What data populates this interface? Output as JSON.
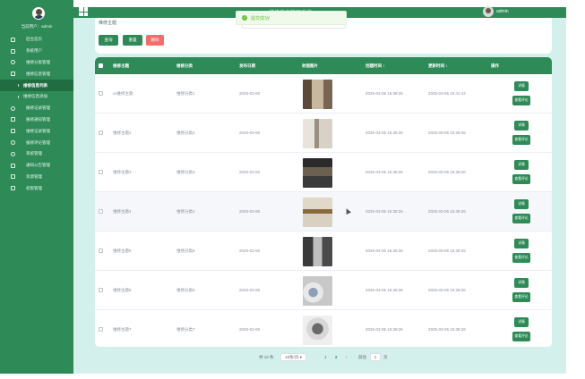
{
  "topbar": {
    "title": "维修信息管理系统",
    "user": "admin"
  },
  "toast": {
    "text": "提交成功!",
    "color": "#67c23a"
  },
  "sidebar": {
    "user_label": "当前用户：admin",
    "items": [
      {
        "label": "后台首页",
        "icon": "home-icon"
      },
      {
        "label": "系统用户",
        "icon": "users-icon"
      },
      {
        "label": "维修分类管理",
        "icon": "category-icon"
      },
      {
        "label": "维修信息管理",
        "icon": "document-icon"
      },
      {
        "label": "维修信息列表",
        "icon": "list-icon",
        "active": true
      },
      {
        "label": "维修信息添加",
        "icon": "add-icon"
      },
      {
        "label": "报修记录管理",
        "icon": "record-icon"
      },
      {
        "label": "报修通知管理",
        "icon": "notice-icon"
      },
      {
        "label": "维修记录管理",
        "icon": "wrench-icon"
      },
      {
        "label": "报修评论管理",
        "icon": "comment-icon"
      },
      {
        "label": "系统管理",
        "icon": "settings-icon"
      },
      {
        "label": "通知公告管理",
        "icon": "bell-icon"
      },
      {
        "label": "资源管理",
        "icon": "folder-icon"
      },
      {
        "label": "权限管理",
        "icon": "lock-icon"
      }
    ]
  },
  "search": {
    "label": "维修主题",
    "placeholder": "",
    "query_button": "查询",
    "reset_button": "重置",
    "delete_button": "删除"
  },
  "table": {
    "headers": [
      "维修主题",
      "维修分类",
      "发布日期",
      "封面图片",
      "创建时间 ↕",
      "更新时间 ↕",
      "操作"
    ],
    "rows": [
      {
        "title": "xx维修主题",
        "category": "维修分类1",
        "date": "2025-03-06",
        "created": "2025-03-06 15:38:26",
        "updated": "2025-03-06 15:41:42"
      },
      {
        "title": "维修主题2",
        "category": "维修分类2",
        "date": "2025-03-06",
        "created": "2025-03-06 15:38:26",
        "updated": "2025-03-06 15:38:26"
      },
      {
        "title": "维修主题3",
        "category": "维修分类3",
        "date": "2025-03-06",
        "created": "2025-03-06 15:38:26",
        "updated": "2025-03-06 15:38:26"
      },
      {
        "title": "维修主题4",
        "category": "维修分类4",
        "date": "2025-03-06",
        "created": "2025-03-06 15:38:26",
        "updated": "2025-03-06 15:38:26"
      },
      {
        "title": "维修主题5",
        "category": "维修分类5",
        "date": "2025-03-06",
        "created": "2025-03-06 15:38:26",
        "updated": "2025-03-06 15:38:26"
      },
      {
        "title": "维修主题6",
        "category": "维修分类6",
        "date": "2025-03-06",
        "created": "2025-03-06 15:38:26",
        "updated": "2025-03-06 15:38:26"
      },
      {
        "title": "维修主题7",
        "category": "维修分类7",
        "date": "2025-03-06",
        "created": "2025-03-06 15:38:26",
        "updated": "2025-03-06 15:38:26"
      }
    ],
    "detail_button": "详情",
    "comment_button": "查看评论"
  },
  "pagination": {
    "total": "共 12 条",
    "page_size": "10条/页",
    "pages": [
      "1",
      "2"
    ],
    "current_page": "2",
    "goto_label": "前往",
    "goto_value": "1",
    "goto_suffix": "页"
  }
}
